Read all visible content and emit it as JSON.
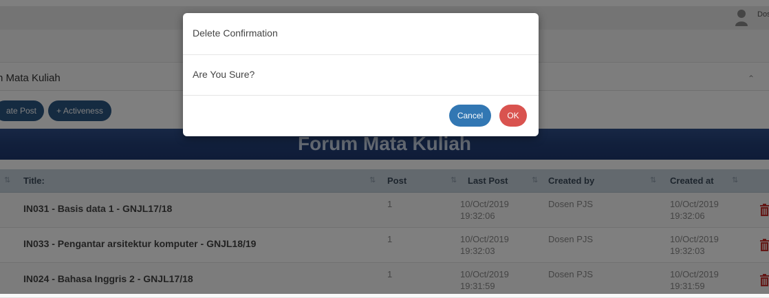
{
  "topbar": {
    "user_name": "Dos"
  },
  "panel": {
    "title": "n Mata Kuliah"
  },
  "actions": {
    "create_post_label": "ate Post",
    "activeness_label": "+ Activeness"
  },
  "banner": {
    "title": "Forum Mata Kuliah"
  },
  "table": {
    "columns": [
      "Title:",
      "Post",
      "Last Post",
      "Created by",
      "Created at"
    ],
    "rows": [
      {
        "title": "IN031 - Basis data 1 - GNJL17/18",
        "post": "1",
        "last_post_date": "10/Oct/2019",
        "last_post_time": "19:32:06",
        "created_by": "Dosen PJS",
        "created_at_date": "10/Oct/2019",
        "created_at_time": "19:32:06"
      },
      {
        "title": "IN033 - Pengantar arsitektur komputer - GNJL18/19",
        "post": "1",
        "last_post_date": "10/Oct/2019",
        "last_post_time": "19:32:03",
        "created_by": "Dosen PJS",
        "created_at_date": "10/Oct/2019",
        "created_at_time": "19:32:03"
      },
      {
        "title": "IN024 - Bahasa Inggris 2 - GNJL17/18",
        "post": "1",
        "last_post_date": "10/Oct/2019",
        "last_post_time": "19:31:59",
        "created_by": "Dosen PJS",
        "created_at_date": "10/Oct/2019",
        "created_at_time": "19:31:59"
      }
    ]
  },
  "modal": {
    "title": "Delete Confirmation",
    "message": "Are You Sure?",
    "cancel_label": "Cancel",
    "ok_label": "OK"
  },
  "colors": {
    "primary": "#2b5683",
    "danger": "#d9534f",
    "cancel": "#3277b3",
    "trash": "#c9302c",
    "banner": "#233f78"
  }
}
